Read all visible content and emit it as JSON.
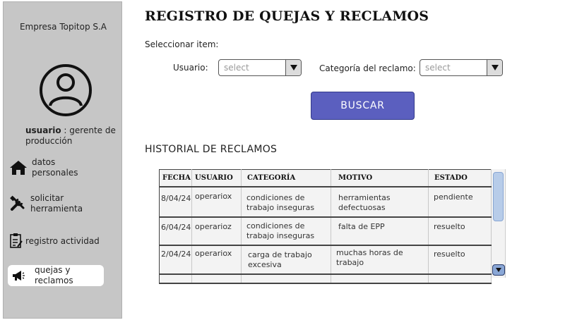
{
  "sidebar": {
    "company": "Empresa Topitop S.A",
    "user_label": "usuario",
    "user_role": " : gerente de producción",
    "items": [
      {
        "label": "datos personales",
        "icon": "home-icon"
      },
      {
        "label": "solicitar herramienta",
        "icon": "tools-icon"
      },
      {
        "label": "registro actividad",
        "icon": "clipboard-icon"
      },
      {
        "label": "quejas y reclamos",
        "icon": "megaphone-icon",
        "active": true
      }
    ]
  },
  "main": {
    "title": "REGISTRO DE QUEJAS Y RECLAMOS",
    "select_item_label": "Seleccionar item:",
    "filters": {
      "usuario_label": "Usuario:",
      "usuario_value": "select",
      "categoria_label": "Categoría del reclamo:",
      "categoria_value": "select"
    },
    "search_button": "BUSCAR",
    "history_title": "HISTORIAL DE RECLAMOS",
    "table": {
      "headers": [
        "FECHA",
        "USUARIO",
        "CATEGORÍA",
        "MOTIVO",
        "ESTADO"
      ],
      "rows": [
        [
          "8/04/24",
          "operariox",
          "condiciones de trabajo inseguras",
          "herramientas defectuosas",
          "pendiente"
        ],
        [
          "6/04/24",
          "operarioz",
          "condiciones de trabajo inseguras",
          "falta de EPP",
          "resuelto"
        ],
        [
          "2/04/24",
          "operariox",
          "carga de trabajo excesiva",
          "muchas horas de trabajo",
          "resuelto"
        ]
      ]
    }
  },
  "colors": {
    "sidebar_bg": "#c6c6c6",
    "button_bg": "#5b5fbf",
    "scroll_thumb": "#b7cce9"
  }
}
